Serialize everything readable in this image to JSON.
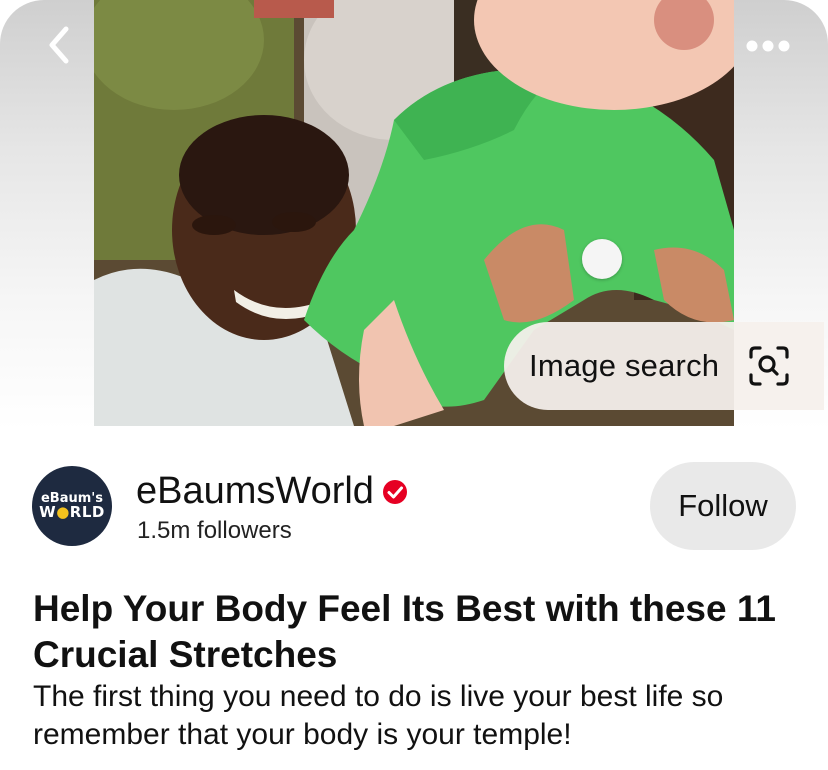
{
  "pin": {
    "image_search_label": "Image search"
  },
  "creator": {
    "name": "eBaumsWorld",
    "followers": "1.5m followers",
    "avatar_text_line1": "eBaum's",
    "avatar_text_line2a": "W",
    "avatar_text_line2b": "RLD",
    "follow_label": "Follow"
  },
  "content": {
    "title": "Help Your Body Feel Its Best with these 11 Crucial Stretches",
    "description": "The first thing you need to do is live your best life so remember that your body is your temple!"
  },
  "icons": {
    "back": "chevron-left-icon",
    "more": "more-horizontal-icon",
    "image_search": "image-search-icon",
    "verified": "verified-check-icon"
  },
  "colors": {
    "verified_red": "#e60023",
    "follow_bg": "#e9e9e9",
    "avatar_bg": "#1e2a40",
    "shirt_green": "#4fc760"
  }
}
